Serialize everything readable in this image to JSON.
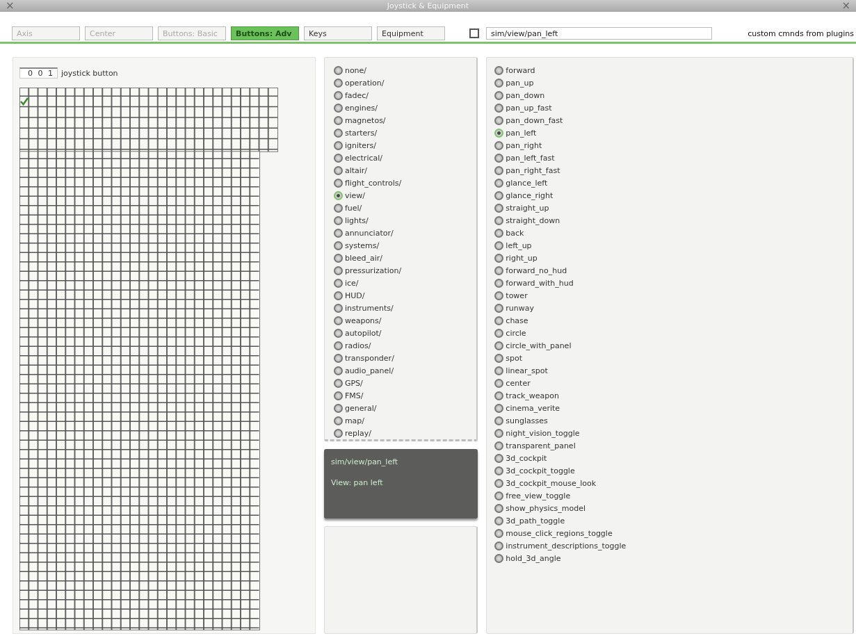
{
  "window": {
    "title": "Joystick & Equipment",
    "close_left": "×",
    "close_right": "×"
  },
  "tabs": [
    {
      "label": "Axis",
      "selected": false,
      "disabled": true
    },
    {
      "label": "Center",
      "selected": false,
      "disabled": true
    },
    {
      "label": "Buttons: Basic",
      "selected": false,
      "disabled": true
    },
    {
      "label": "Buttons: Adv",
      "selected": true,
      "disabled": false
    },
    {
      "label": "Keys",
      "selected": false,
      "disabled": false
    },
    {
      "label": "Equipment",
      "selected": false,
      "disabled": false
    }
  ],
  "command_bar": {
    "checked": false,
    "value": "sim/view/pan_left",
    "note": "custom cmnds from plugins"
  },
  "button_panel": {
    "number": "0 0 1",
    "label": "joystick button",
    "first_button_checked": true
  },
  "groups": [
    {
      "label": "none/",
      "selected": false
    },
    {
      "label": "operation/",
      "selected": false
    },
    {
      "label": "fadec/",
      "selected": false
    },
    {
      "label": "engines/",
      "selected": false
    },
    {
      "label": "magnetos/",
      "selected": false
    },
    {
      "label": "starters/",
      "selected": false
    },
    {
      "label": "igniters/",
      "selected": false
    },
    {
      "label": "electrical/",
      "selected": false
    },
    {
      "label": "altair/",
      "selected": false
    },
    {
      "label": "flight_controls/",
      "selected": false
    },
    {
      "label": "view/",
      "selected": true
    },
    {
      "label": "fuel/",
      "selected": false
    },
    {
      "label": "lights/",
      "selected": false
    },
    {
      "label": "annunciator/",
      "selected": false
    },
    {
      "label": "systems/",
      "selected": false
    },
    {
      "label": "bleed_air/",
      "selected": false
    },
    {
      "label": "pressurization/",
      "selected": false
    },
    {
      "label": "ice/",
      "selected": false
    },
    {
      "label": "HUD/",
      "selected": false
    },
    {
      "label": "instruments/",
      "selected": false
    },
    {
      "label": "weapons/",
      "selected": false
    },
    {
      "label": "autopilot/",
      "selected": false
    },
    {
      "label": "radios/",
      "selected": false
    },
    {
      "label": "transponder/",
      "selected": false
    },
    {
      "label": "audio_panel/",
      "selected": false
    },
    {
      "label": "GPS/",
      "selected": false
    },
    {
      "label": "FMS/",
      "selected": false
    },
    {
      "label": "general/",
      "selected": false
    },
    {
      "label": "map/",
      "selected": false
    },
    {
      "label": "replay/",
      "selected": false
    }
  ],
  "description": {
    "command": "sim/view/pan_left",
    "text": "View: pan left"
  },
  "commands": [
    {
      "label": "forward",
      "selected": false
    },
    {
      "label": "pan_up",
      "selected": false
    },
    {
      "label": "pan_down",
      "selected": false
    },
    {
      "label": "pan_up_fast",
      "selected": false
    },
    {
      "label": "pan_down_fast",
      "selected": false
    },
    {
      "label": "pan_left",
      "selected": true
    },
    {
      "label": "pan_right",
      "selected": false
    },
    {
      "label": "pan_left_fast",
      "selected": false
    },
    {
      "label": "pan_right_fast",
      "selected": false
    },
    {
      "label": "glance_left",
      "selected": false
    },
    {
      "label": "glance_right",
      "selected": false
    },
    {
      "label": "straight_up",
      "selected": false
    },
    {
      "label": "straight_down",
      "selected": false
    },
    {
      "label": "back",
      "selected": false
    },
    {
      "label": "left_up",
      "selected": false
    },
    {
      "label": "right_up",
      "selected": false
    },
    {
      "label": "forward_no_hud",
      "selected": false
    },
    {
      "label": "forward_with_hud",
      "selected": false
    },
    {
      "label": "tower",
      "selected": false
    },
    {
      "label": "runway",
      "selected": false
    },
    {
      "label": "chase",
      "selected": false
    },
    {
      "label": "circle",
      "selected": false
    },
    {
      "label": "circle_with_panel",
      "selected": false
    },
    {
      "label": "spot",
      "selected": false
    },
    {
      "label": "linear_spot",
      "selected": false
    },
    {
      "label": "center",
      "selected": false
    },
    {
      "label": "track_weapon",
      "selected": false
    },
    {
      "label": "cinema_verite",
      "selected": false
    },
    {
      "label": "sunglasses",
      "selected": false
    },
    {
      "label": "night_vision_toggle",
      "selected": false
    },
    {
      "label": "transparent_panel",
      "selected": false
    },
    {
      "label": "3d_cockpit",
      "selected": false
    },
    {
      "label": "3d_cockpit_toggle",
      "selected": false
    },
    {
      "label": "3d_cockpit_mouse_look",
      "selected": false
    },
    {
      "label": "free_view_toggle",
      "selected": false
    },
    {
      "label": "show_physics_model",
      "selected": false
    },
    {
      "label": "3d_path_toggle",
      "selected": false
    },
    {
      "label": "mouse_click_regions_toggle",
      "selected": false
    },
    {
      "label": "instrument_descriptions_toggle",
      "selected": false
    },
    {
      "label": "hold_3d_angle",
      "selected": false
    }
  ]
}
